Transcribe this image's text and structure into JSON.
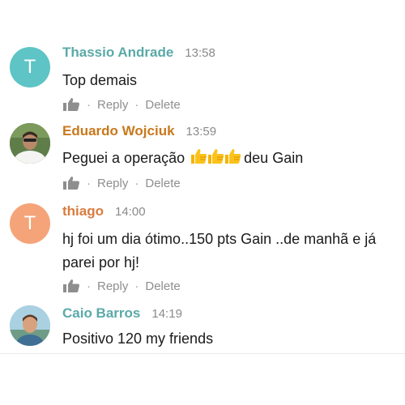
{
  "comments": [
    {
      "author": "Thassio Andrade",
      "time": "13:58",
      "text": "Top demais",
      "avatar_letter": "T",
      "avatar_color": "#5ec4c5",
      "name_color": "#5aa9a8",
      "reply_label": "Reply",
      "delete_label": "Delete"
    },
    {
      "author": "Eduardo Wojciuk",
      "time": "13:59",
      "text_before": "Peguei a operação",
      "text_after": "deu Gain",
      "emoji": [
        "thumbs-up",
        "thumbs-up",
        "thumbs-up"
      ],
      "name_color": "#c8781b",
      "reply_label": "Reply",
      "delete_label": "Delete"
    },
    {
      "author": "thiago",
      "time": "14:00",
      "text": "hj foi um dia ótimo..150 pts Gain ..de manhã e já parei por hj!",
      "avatar_letter": "T",
      "avatar_color": "#f4a478",
      "name_color": "#d97c3e",
      "reply_label": "Reply",
      "delete_label": "Delete"
    },
    {
      "author": "Caio Barros",
      "time": "14:19",
      "text": "Positivo 120 my friends",
      "name_color": "#5aa9a8"
    }
  ]
}
